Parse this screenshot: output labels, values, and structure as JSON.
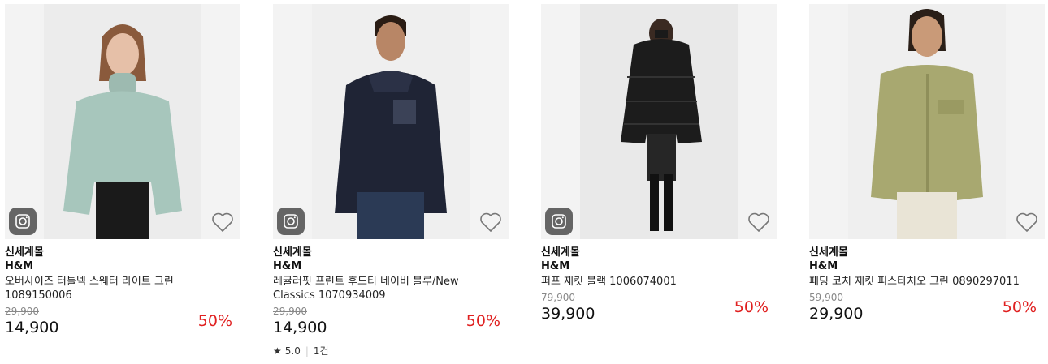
{
  "products": [
    {
      "mall": "신세계몰",
      "brand": "H&M",
      "title": "오버사이즈 터틀넥 스웨터 라이트 그린 1089150006",
      "original_price": "29,900",
      "price": "14,900",
      "discount": "50%",
      "has_camera_badge": true
    },
    {
      "mall": "신세계몰",
      "brand": "H&M",
      "title": "레귤러핏 프린트 후드티 네이비 블루/New Classics 1070934009",
      "original_price": "29,900",
      "price": "14,900",
      "discount": "50%",
      "has_camera_badge": true,
      "rating": "5.0",
      "review_count": "1건"
    },
    {
      "mall": "신세계몰",
      "brand": "H&M",
      "title": "퍼프 재킷 블랙 1006074001",
      "original_price": "79,900",
      "price": "39,900",
      "discount": "50%",
      "has_camera_badge": true
    },
    {
      "mall": "신세계몰",
      "brand": "H&M",
      "title": "패딩 코치 재킷 피스타치오 그린 0890297011",
      "original_price": "59,900",
      "price": "29,900",
      "discount": "50%",
      "has_camera_badge": false
    }
  ],
  "colors": {
    "discount": "#e02020",
    "strike": "#888888"
  },
  "icons": {
    "camera": "camera-icon",
    "wishlist": "heart-icon",
    "star": "star-icon"
  }
}
